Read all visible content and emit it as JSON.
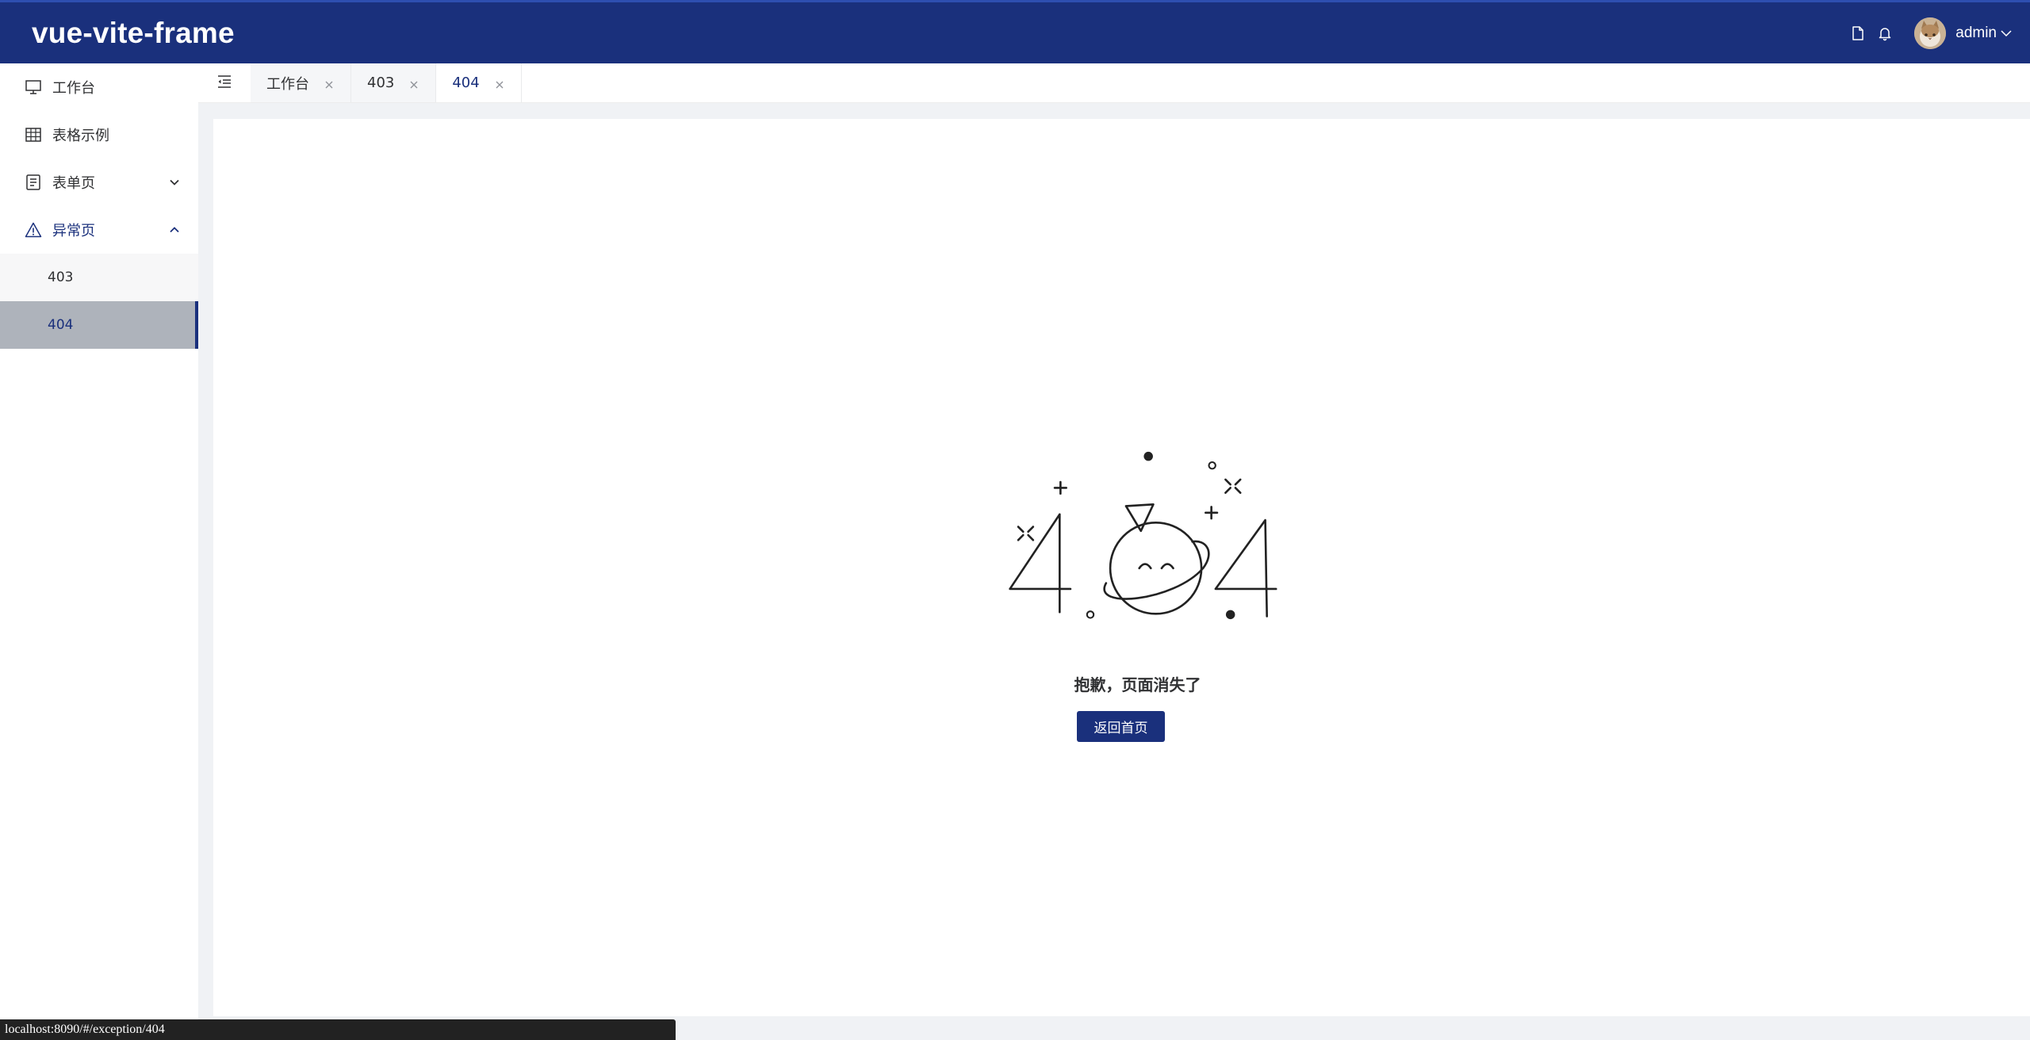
{
  "app": {
    "title": "vue-vite-frame",
    "username": "admin"
  },
  "header": {
    "icons": [
      "document-icon",
      "bell-icon",
      "avatar",
      "chevron-down-icon"
    ]
  },
  "sidebar": {
    "items": [
      {
        "label": "工作台",
        "icon": "monitor-icon"
      },
      {
        "label": "表格示例",
        "icon": "table-icon"
      },
      {
        "label": "表单页",
        "icon": "form-icon",
        "expanded": false
      },
      {
        "label": "异常页",
        "icon": "warning-icon",
        "expanded": true,
        "children": [
          {
            "label": "403"
          },
          {
            "label": "404",
            "selected": true
          }
        ]
      }
    ]
  },
  "tabs": [
    {
      "label": "工作台"
    },
    {
      "label": "403"
    },
    {
      "label": "404",
      "active": true
    }
  ],
  "exception": {
    "message": "抱歉，页面消失了",
    "button": "返回首页"
  },
  "status_bar": {
    "url": "localhost:8090/#/exception/404"
  },
  "colors": {
    "brand": "#1a307c",
    "selected_bg": "#aeb3bb",
    "page_bg": "#f0f2f5"
  }
}
